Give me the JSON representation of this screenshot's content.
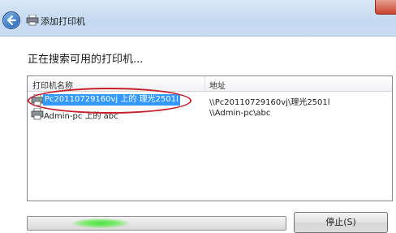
{
  "window": {
    "title": "添加打印机"
  },
  "main": {
    "heading": "正在搜索可用的打印机...",
    "columns": {
      "name": "打印机名称",
      "address": "地址"
    },
    "printers": [
      {
        "name": "Pc20110729160vj 上的 理光2501l",
        "address": "\\\\Pc20110729160vj\\理光2501l",
        "selected": true
      },
      {
        "name": "Admin-pc 上的 abc",
        "address": "\\\\Admin-pc\\abc",
        "selected": false
      }
    ]
  },
  "footer": {
    "stop_label": "停止(S)"
  },
  "colors": {
    "selection": "#3399ff",
    "annotation": "#c8202a",
    "progress": "#4fe04a"
  }
}
